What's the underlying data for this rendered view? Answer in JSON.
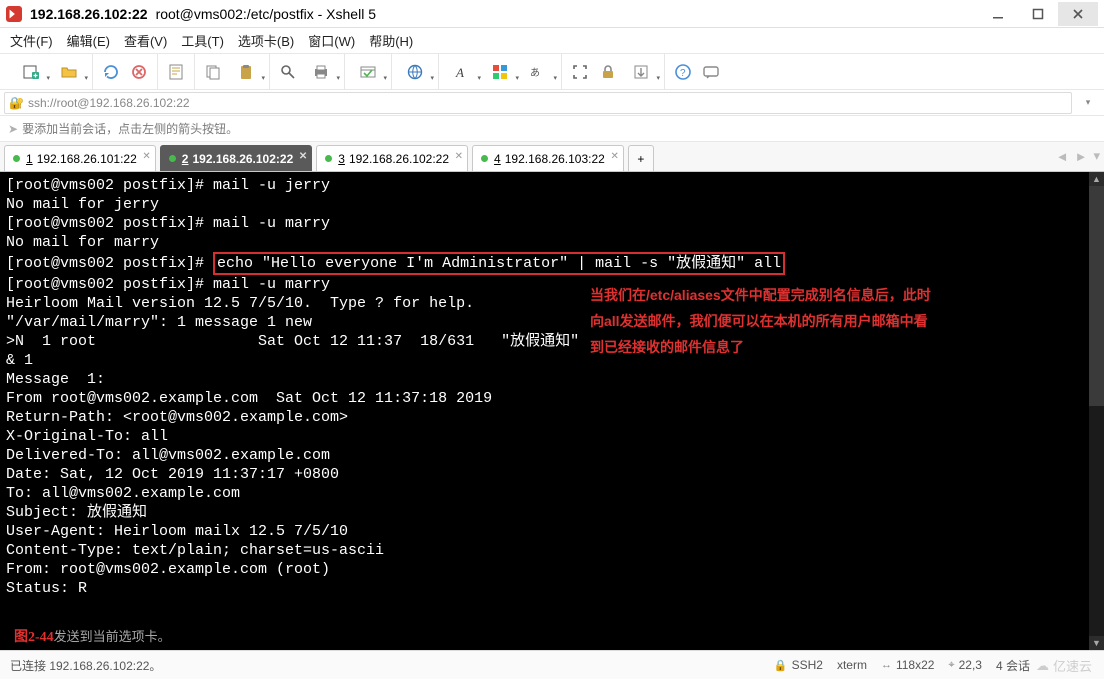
{
  "window": {
    "host": "192.168.26.102:22",
    "title_path": "root@vms002:/etc/postfix - Xshell 5"
  },
  "menubar": [
    "文件(F)",
    "编辑(E)",
    "查看(V)",
    "工具(T)",
    "选项卡(B)",
    "窗口(W)",
    "帮助(H)"
  ],
  "addressbar": {
    "url": "ssh://root@192.168.26.102:22"
  },
  "hintbar": {
    "text": "要添加当前会话，点击左侧的箭头按钮。"
  },
  "tabs": [
    {
      "num": "1",
      "label": "192.168.26.101:22",
      "active": false
    },
    {
      "num": "2",
      "label": "192.168.26.102:22",
      "active": true
    },
    {
      "num": "3",
      "label": "192.168.26.102:22",
      "active": false
    },
    {
      "num": "4",
      "label": "192.168.26.103:22",
      "active": false
    }
  ],
  "terminal": {
    "lines_pre": "[root@vms002 postfix]# mail -u jerry\nNo mail for jerry\n[root@vms002 postfix]# mail -u marry\nNo mail for marry\n",
    "hl_prompt": "[root@vms002 postfix]# ",
    "hl_cmd": "echo \"Hello everyone I'm Administrator\" | mail -s \"放假通知\" all",
    "lines_post": "[root@vms002 postfix]# mail -u marry\nHeirloom Mail version 12.5 7/5/10.  Type ? for help.\n\"/var/mail/marry\": 1 message 1 new\n>N  1 root                  Sat Oct 12 11:37  18/631   \"放假通知\"\n& 1\nMessage  1:\nFrom root@vms002.example.com  Sat Oct 12 11:37:18 2019\nReturn-Path: <root@vms002.example.com>\nX-Original-To: all\nDelivered-To: all@vms002.example.com\nDate: Sat, 12 Oct 2019 11:37:17 +0800\nTo: all@vms002.example.com\nSubject: 放假通知\nUser-Agent: Heirloom mailx 12.5 7/5/10\nContent-Type: text/plain; charset=us-ascii\nFrom: root@vms002.example.com (root)\nStatus: R\n"
  },
  "annotation": {
    "l1": "当我们在/etc/aliases文件中配置完成别名信息后，此时",
    "l2": "向all发送邮件，我们便可以在本机的所有用户邮箱中看",
    "l3": "到已经接收的邮件信息了"
  },
  "figure": {
    "label": "图2-44",
    "sub": "发送到当前选项卡。"
  },
  "statusbar": {
    "conn": "已连接 192.168.26.102:22。",
    "proto": "SSH2",
    "term": "xterm",
    "size": "118x22",
    "pos": "22,3",
    "sessions": "4 会话"
  },
  "watermark": "亿速云",
  "icons": {
    "connect": "connect",
    "new": "new",
    "open": "open",
    "save": "save",
    "copy": "copy",
    "paste": "paste",
    "find": "find",
    "print": "print",
    "props": "props",
    "web": "web",
    "font": "font",
    "color": "color",
    "encode": "encode",
    "fullscreen": "fs",
    "transparent": "tp",
    "lock": "lock",
    "reconnect": "rc",
    "help": "help",
    "chat": "chat"
  }
}
